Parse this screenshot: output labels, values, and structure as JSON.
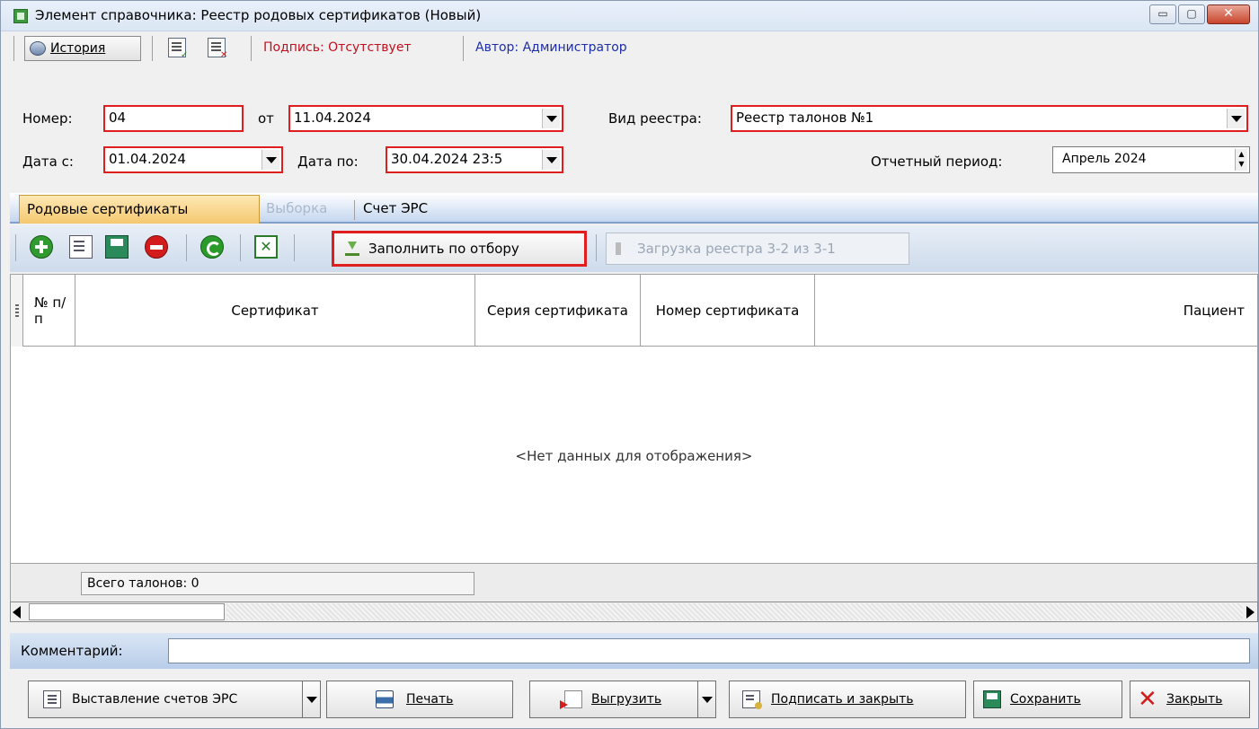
{
  "window": {
    "title": "Элемент справочника: Реестр родовых сертификатов (Новый)",
    "min_glyph": "▭",
    "max_glyph": "▢",
    "close_glyph": "✕"
  },
  "doc_toolbar": {
    "history_label": "История",
    "signature_text": "Подпись: Отсутствует",
    "author_text": "Автор: Администратор",
    "signature_color": "#c0101e",
    "author_color": "#1d2ea8"
  },
  "form": {
    "number_label": "Номер:",
    "number_value": "04",
    "from_label": "от",
    "from_value": "11.04.2024",
    "registry_type_label": "Вид реестра:",
    "registry_type_value": "Реестр талонов №1",
    "date_from_label": "Дата с:",
    "date_from_value": "01.04.2024",
    "date_to_label": "Дата по:",
    "date_to_value": "30.04.2024 23:5",
    "period_label": "Отчетный период:",
    "period_value": "Апрель  2024"
  },
  "tabs": [
    {
      "label": "Родовые сертификаты",
      "state": "active"
    },
    {
      "label": "Выборка",
      "state": "disabled"
    },
    {
      "label": "Счет ЭРС",
      "state": "normal"
    }
  ],
  "grid_toolbar": {
    "icons": [
      "add-icon",
      "edit-icon",
      "save-icon",
      "delete-icon",
      "refresh-icon",
      "excel-icon"
    ],
    "fill_button_label": "Заполнить по отбору",
    "load_button_label": "Загрузка реестра 3-2 из 3-1"
  },
  "grid": {
    "columns": [
      {
        "label": "№ п/п"
      },
      {
        "label": "Сертификат"
      },
      {
        "label": "Серия сертификата"
      },
      {
        "label": "Номер сертификата"
      },
      {
        "label": "Пациент"
      }
    ],
    "empty_text": "<Нет данных для отображения>",
    "total_text": "Всего талонов: 0"
  },
  "comment": {
    "label": "Комментарий:",
    "value": ""
  },
  "bottom_buttons": {
    "issue_invoices": "Выставление счетов ЭРС",
    "print": "Печать",
    "export": "Выгрузить",
    "sign_close": "Подписать и закрыть",
    "save": "Сохранить",
    "close": "Закрыть"
  },
  "colors": {
    "highlight_border": "#e01e1e",
    "active_tab": "#f5c970",
    "toolbar_blue": "#c3d6ef"
  }
}
